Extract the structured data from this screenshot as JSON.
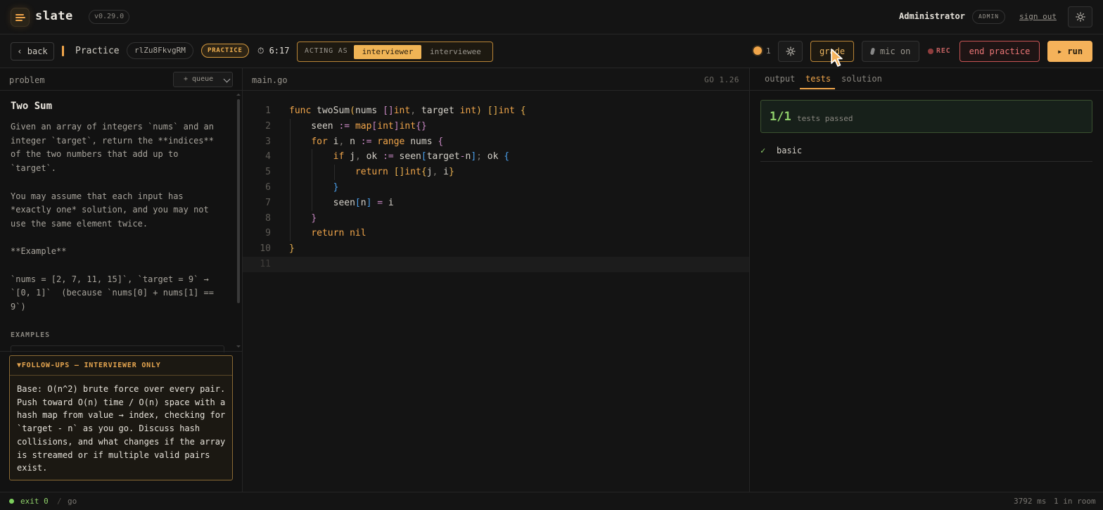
{
  "header": {
    "brand": "slate",
    "version": "v0.29.0",
    "user_name": "Administrator",
    "role_badge": "ADMIN",
    "sign_out": "sign out",
    "icons": [
      "logo-icon",
      "sun-icon"
    ]
  },
  "toolbar": {
    "back_label": "‹ back",
    "title": "Practice",
    "room_id": "rlZu8FkvgRM",
    "mode_badge": "PRACTICE",
    "timer": "⏱ 6:17",
    "acting_as_label": "ACTING AS",
    "roles": [
      "interviewer",
      "interviewee"
    ],
    "active_role": "interviewer",
    "presence_count": "1",
    "grade_label": "grade",
    "mic_label": "mic on",
    "rec_label": "REC",
    "end_label": "end practice",
    "run_label": "▸ run"
  },
  "problem_panel": {
    "header_label": "problem",
    "queue_label": "+ queue",
    "title": "Two Sum",
    "description": "Given an array of integers `nums` and an integer `target`, return the **indices** of the two numbers that add up to `target`.\n\nYou may assume that each input has *exactly one* solution, and you may not use the same element twice.\n\n**Example**\n\n`nums = [2, 7, 11, 15]`, `target = 9` → `[0, 1]`  (because `nums[0] + nums[1] == 9`)",
    "examples_heading": "EXAMPLES",
    "followups_heading": "▼FOLLOW-UPS — INTERVIEWER ONLY",
    "followups_text": "Base: O(n^2) brute force over every pair. Push toward O(n) time / O(n) space with a hash map from value → index, checking for `target - n` as you go. Discuss hash collisions, and what changes if the array is streamed or if multiple valid pairs exist."
  },
  "editor": {
    "filename": "main.go",
    "language": "GO 1.26",
    "line_numbers": [
      "1",
      "2",
      "3",
      "4",
      "5",
      "6",
      "7",
      "8",
      "9",
      "10",
      "11"
    ],
    "active_line": 11,
    "code_lines": [
      "func twoSum(nums []int, target int) []int {",
      "    seen := map[int]int{}",
      "    for i, n := range nums {",
      "        if j, ok := seen[target-n]; ok {",
      "            return []int{j, i}",
      "        }",
      "        seen[n] = i",
      "    }",
      "    return nil",
      "}",
      ""
    ]
  },
  "results_panel": {
    "tabs": [
      "output",
      "tests",
      "solution"
    ],
    "active_tab": "tests",
    "pass_count": "1/1",
    "pass_label": "tests passed",
    "tests": [
      {
        "status": "✓",
        "name": "basic"
      }
    ]
  },
  "status_bar": {
    "exit": "exit 0",
    "separator": "/",
    "language": "go",
    "duration": "3792 ms",
    "room_count": "1 in room"
  },
  "colors": {
    "accent": "#f0a54a",
    "success": "#8fd06a",
    "danger": "#ec7676",
    "background": "#111111"
  }
}
